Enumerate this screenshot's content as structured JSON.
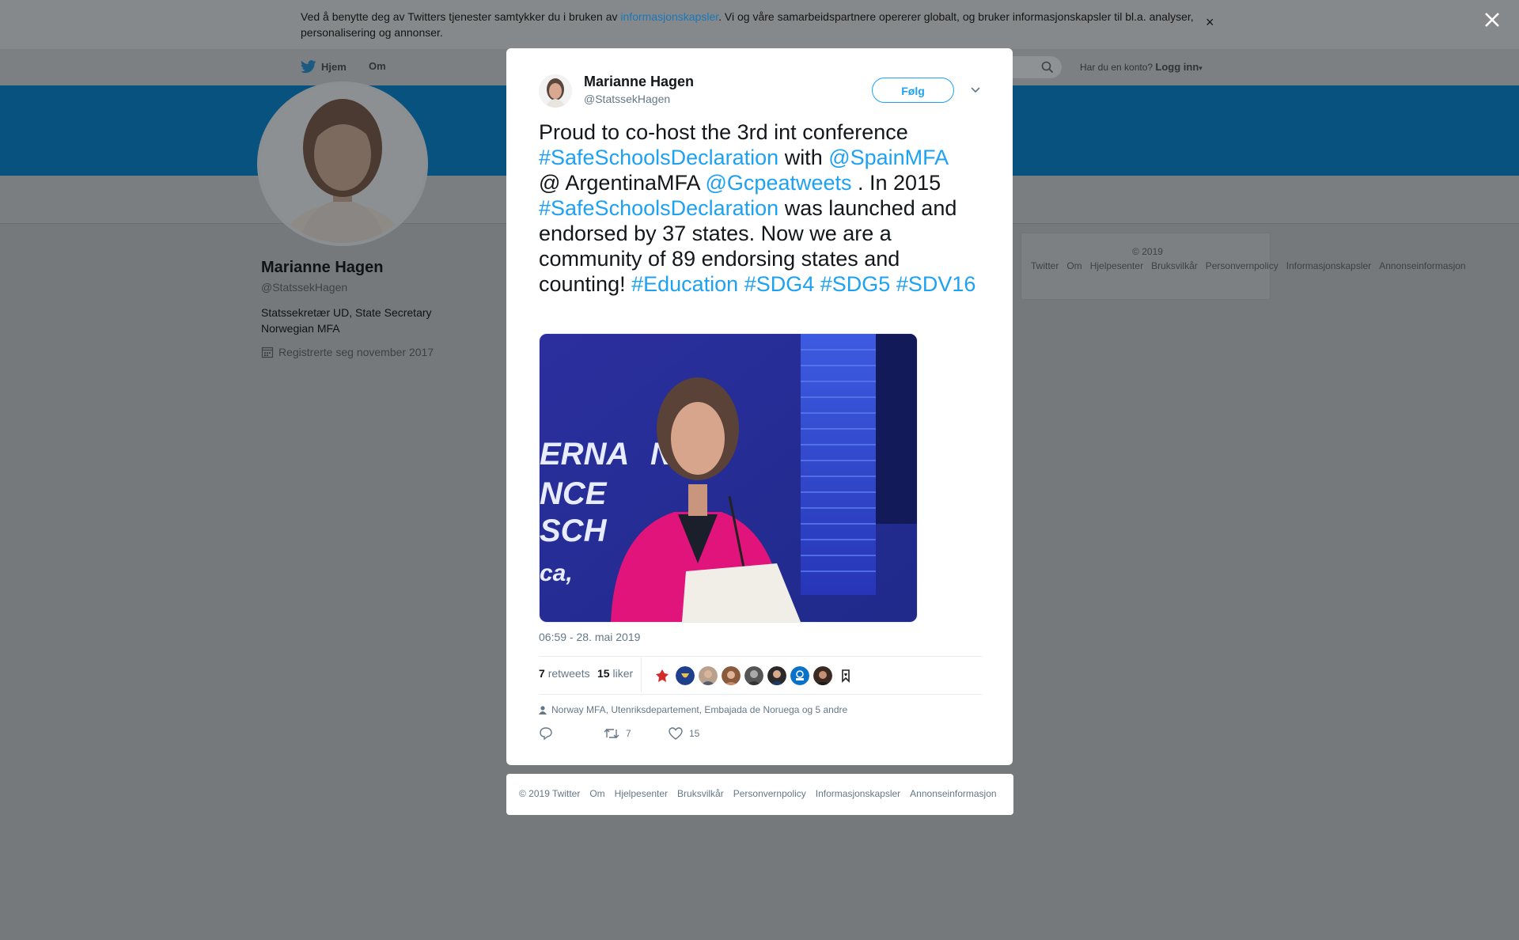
{
  "cookie": {
    "text_before": "Ved å benytte deg av Twitters tjenester samtykker du i bruken av ",
    "link": "informasjonskapsler",
    "text_after": ". Vi og våre samarbeidspartnere opererer globalt, og bruker informasjonskapsler til bl.a. analyser, personalisering og annonser.",
    "close": "×"
  },
  "nav": {
    "home": "Hjem",
    "about": "Om",
    "account_question": "Har du en konto?",
    "login": "Logg inn"
  },
  "profile": {
    "name": "Marianne Hagen",
    "handle": "@StatssekHagen",
    "bio": "Statssekretær UD, State Secretary Norwegian MFA",
    "joined": "Registrerte seg november 2017"
  },
  "side_footer": {
    "links": [
      "© 2019 Twitter",
      "Om",
      "Hjelpesenter",
      "Bruksvilkår",
      "Personvernpolicy",
      "Informasjonskapsler",
      "Annonseinformasjon"
    ]
  },
  "tweet": {
    "author_name": "Marianne Hagen",
    "author_handle": "@StatssekHagen",
    "follow_label": "Følg",
    "text": {
      "t1": "Proud to co-host the 3rd int conference ",
      "h1": "#SafeSchoolsDeclaration",
      "t2": " with ",
      "m1": "@SpainMFA",
      "t3": "@ ArgentinaMFA ",
      "m2": "@Gcpeatweets",
      "t4": " . In 2015 ",
      "h2": "#SafeSchoolsDeclaration",
      "t5": " was launched and endorsed by 37 states. Now we are a community of 89 endorsing states and counting! ",
      "h3": "#Education",
      "h4": "#SDG4",
      "h5": "#SDG5",
      "h6": "#SDV16"
    },
    "image_text": "ERNATIONAL NCE SCH ca,",
    "timestamp": "06:59 - 28. mai 2019",
    "retweets_count": "7",
    "retweets_label": "retweets",
    "likes_count": "15",
    "likes_label": "liker",
    "context": "Norway MFA, Utenriksdepartement, Embajada de Noruega og 5 andre",
    "action_retweets": "7",
    "action_likes": "15"
  },
  "modal_footer": {
    "links": [
      "© 2019 Twitter",
      "Om",
      "Hjelpesenter",
      "Bruksvilkår",
      "Personvernpolicy",
      "Informasjonskapsler",
      "Annonseinformasjon"
    ]
  },
  "colors": {
    "accent": "#1da1f2",
    "overlay": "#75797b",
    "banner": "#08527f"
  }
}
